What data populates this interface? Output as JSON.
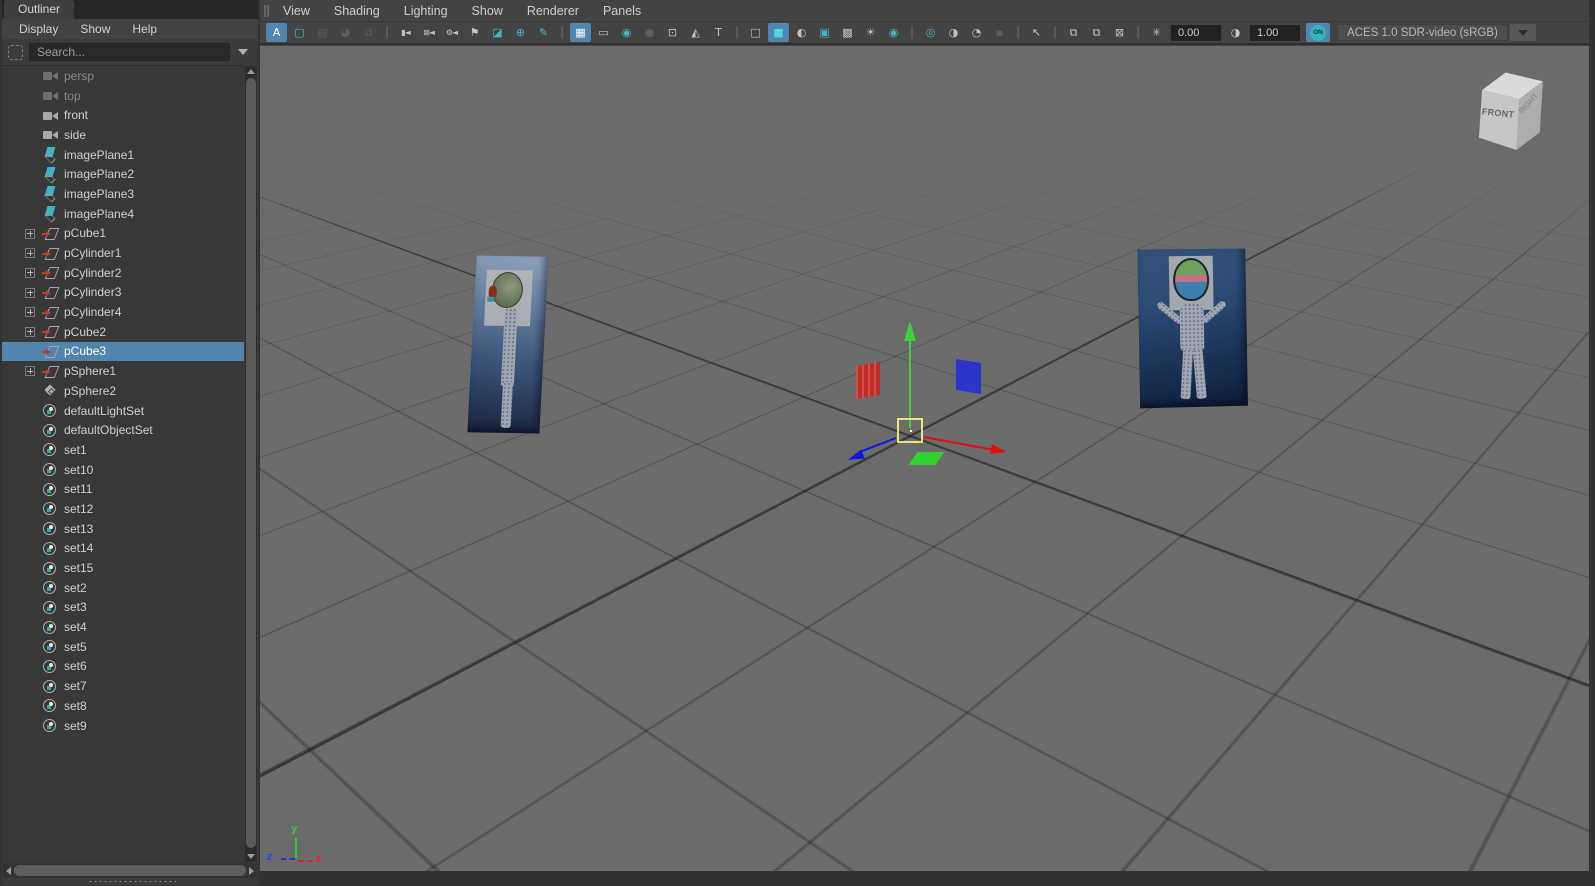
{
  "colors": {
    "accent": "#5285ad",
    "teal": "#45b7c4",
    "viewport_bg": "#6b6b6b",
    "panel_bg": "#3b3b3b",
    "selection_text": "#ffffff"
  },
  "outliner": {
    "title": "Outliner",
    "menus": [
      "Display",
      "Show",
      "Help"
    ],
    "search_placeholder": "Search...",
    "items": [
      {
        "label": "persp",
        "icon": "camera",
        "muted": true
      },
      {
        "label": "top",
        "icon": "camera",
        "muted": true
      },
      {
        "label": "front",
        "icon": "camera"
      },
      {
        "label": "side",
        "icon": "camera"
      },
      {
        "label": "imagePlane1",
        "icon": "image-plane"
      },
      {
        "label": "imagePlane2",
        "icon": "image-plane"
      },
      {
        "label": "imagePlane3",
        "icon": "image-plane"
      },
      {
        "label": "imagePlane4",
        "icon": "image-plane"
      },
      {
        "label": "pCube1",
        "icon": "transform",
        "expandable": true
      },
      {
        "label": "pCylinder1",
        "icon": "transform",
        "expandable": true
      },
      {
        "label": "pCylinder2",
        "icon": "transform",
        "expandable": true
      },
      {
        "label": "pCylinder3",
        "icon": "transform",
        "expandable": true
      },
      {
        "label": "pCylinder4",
        "icon": "transform",
        "expandable": true
      },
      {
        "label": "pCube2",
        "icon": "transform",
        "expandable": true
      },
      {
        "label": "pCube3",
        "icon": "transform",
        "selected": true
      },
      {
        "label": "pSphere1",
        "icon": "transform",
        "expandable": true
      },
      {
        "label": "pSphere2",
        "icon": "mesh"
      },
      {
        "label": "defaultLightSet",
        "icon": "set"
      },
      {
        "label": "defaultObjectSet",
        "icon": "set"
      },
      {
        "label": "set1",
        "icon": "set"
      },
      {
        "label": "set10",
        "icon": "set"
      },
      {
        "label": "set11",
        "icon": "set"
      },
      {
        "label": "set12",
        "icon": "set"
      },
      {
        "label": "set13",
        "icon": "set"
      },
      {
        "label": "set14",
        "icon": "set"
      },
      {
        "label": "set15",
        "icon": "set"
      },
      {
        "label": "set2",
        "icon": "set"
      },
      {
        "label": "set3",
        "icon": "set"
      },
      {
        "label": "set4",
        "icon": "set"
      },
      {
        "label": "set5",
        "icon": "set"
      },
      {
        "label": "set6",
        "icon": "set"
      },
      {
        "label": "set7",
        "icon": "set"
      },
      {
        "label": "set8",
        "icon": "set"
      },
      {
        "label": "set9",
        "icon": "set"
      }
    ]
  },
  "viewport": {
    "menus": [
      "View",
      "Shading",
      "Lighting",
      "Show",
      "Renderer",
      "Panels"
    ],
    "toolbar": [
      {
        "type": "btn",
        "name": "letter-a-display",
        "glyph": "A",
        "state": "active"
      },
      {
        "type": "btn",
        "name": "selection-highlight-frame",
        "glyph": "▢",
        "state": "teal"
      },
      {
        "type": "btn",
        "name": "film-gate-small",
        "glyph": "▤",
        "state": "disabled"
      },
      {
        "type": "btn",
        "name": "color-pie",
        "glyph": "◕",
        "state": "disabled"
      },
      {
        "type": "btn",
        "name": "image-stack",
        "glyph": "⧉",
        "state": "disabled"
      },
      {
        "type": "sep"
      },
      {
        "type": "btn",
        "name": "select-camera",
        "glyph": "▮◄",
        "state": "normal",
        "small": true
      },
      {
        "type": "btn",
        "name": "lock-camera",
        "glyph": "⊠◄",
        "state": "normal",
        "small": true
      },
      {
        "type": "btn",
        "name": "camera-attributes",
        "glyph": "⚙◄",
        "state": "normal",
        "small": true
      },
      {
        "type": "btn",
        "name": "bookmarks",
        "glyph": "⚑",
        "state": "normal"
      },
      {
        "type": "btn",
        "name": "image-plane",
        "glyph": "◪",
        "state": "teal"
      },
      {
        "type": "btn",
        "name": "pan-zoom-2d",
        "glyph": "⊕",
        "state": "teal"
      },
      {
        "type": "btn",
        "name": "grease-pencil",
        "glyph": "✎",
        "state": "teal"
      },
      {
        "type": "sep"
      },
      {
        "type": "btn",
        "name": "grid-display",
        "glyph": "▦",
        "state": "active"
      },
      {
        "type": "btn",
        "name": "film-gate",
        "glyph": "▭",
        "state": "normal"
      },
      {
        "type": "btn",
        "name": "resolution-gate",
        "glyph": "◉",
        "state": "teal"
      },
      {
        "type": "btn",
        "name": "gate-mask",
        "glyph": "●",
        "state": "disabled"
      },
      {
        "type": "btn",
        "name": "field-chart",
        "glyph": "⊡",
        "state": "normal"
      },
      {
        "type": "btn",
        "name": "safe-action",
        "glyph": "◭",
        "state": "normal"
      },
      {
        "type": "btn",
        "name": "safe-title",
        "glyph": "T",
        "state": "normal"
      },
      {
        "type": "sep"
      },
      {
        "type": "btn",
        "name": "wireframe-display",
        "glyph": "□",
        "state": "normal"
      },
      {
        "type": "btn",
        "name": "smooth-shade-all",
        "glyph": "■",
        "state": "active-teal"
      },
      {
        "type": "btn",
        "name": "use-default-material",
        "glyph": "◐",
        "state": "normal"
      },
      {
        "type": "btn",
        "name": "shade-object",
        "glyph": "▣",
        "state": "teal"
      },
      {
        "type": "btn",
        "name": "textured-display",
        "glyph": "▩",
        "state": "normal"
      },
      {
        "type": "btn",
        "name": "use-all-lights",
        "glyph": "☀",
        "state": "normal"
      },
      {
        "type": "btn",
        "name": "shadows-display",
        "glyph": "◉",
        "state": "teal"
      },
      {
        "type": "sep"
      },
      {
        "type": "btn",
        "name": "screen-space-ao",
        "glyph": "◎",
        "state": "teal"
      },
      {
        "type": "btn",
        "name": "motion-blur",
        "glyph": "◑",
        "state": "normal"
      },
      {
        "type": "btn",
        "name": "anti-aliasing",
        "glyph": "◔",
        "state": "normal"
      },
      {
        "type": "btn",
        "name": "depth-of-field",
        "glyph": "▪",
        "state": "disabled"
      },
      {
        "type": "sep"
      },
      {
        "type": "btn",
        "name": "isolate-select",
        "glyph": "↖",
        "state": "normal"
      },
      {
        "type": "sep"
      },
      {
        "type": "btn",
        "name": "xray-display",
        "glyph": "⧉",
        "state": "normal"
      },
      {
        "type": "btn",
        "name": "xray-active-components",
        "glyph": "⧉",
        "state": "normal"
      },
      {
        "type": "btn",
        "name": "xray-joints",
        "glyph": "⊠",
        "state": "normal"
      },
      {
        "type": "sep"
      },
      {
        "type": "btn",
        "name": "exposure-toggle",
        "glyph": "✳",
        "state": "normal"
      },
      {
        "type": "field",
        "name": "exposure-value",
        "text": "0.00"
      },
      {
        "type": "btn",
        "name": "gamma-toggle",
        "glyph": "◑",
        "state": "normal"
      },
      {
        "type": "field",
        "name": "gamma-value",
        "text": "1.00"
      },
      {
        "type": "on",
        "name": "color-managed-toggle",
        "text": "ON"
      },
      {
        "type": "dropdown",
        "name": "view-transform-select",
        "text": "ACES 1.0 SDR-video (sRGB)"
      },
      {
        "type": "drop-arrow",
        "name": "view-transform-arrow"
      }
    ],
    "viewcube": {
      "front": "FRONT",
      "right": "RIGHT"
    },
    "axis": {
      "x": "x",
      "y": "y",
      "z": "z"
    }
  }
}
